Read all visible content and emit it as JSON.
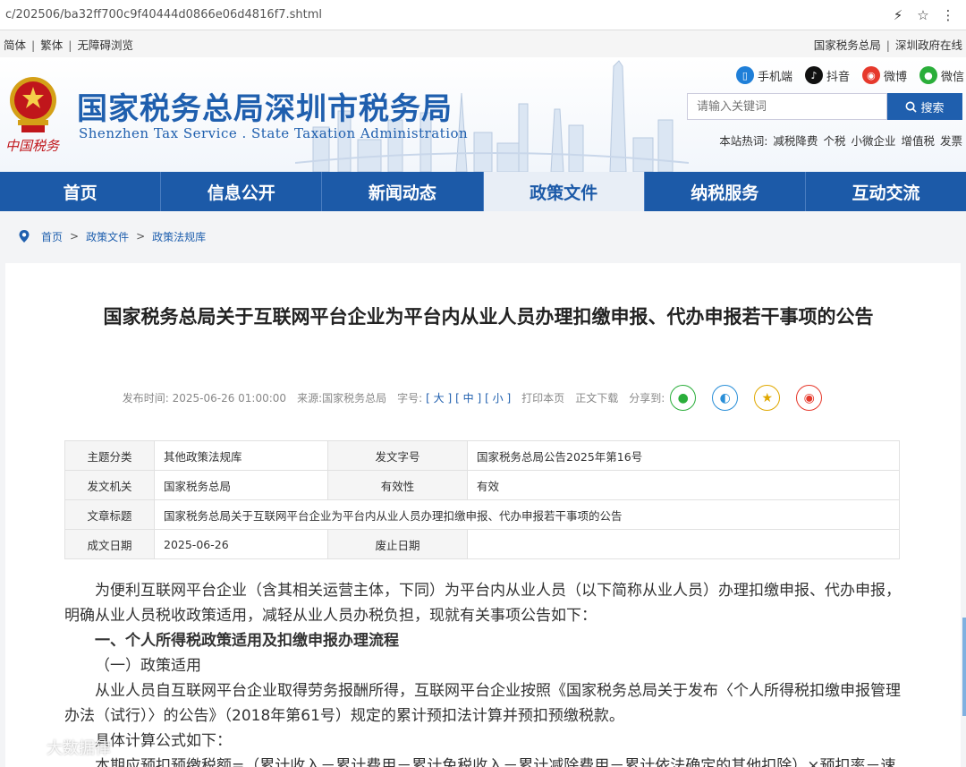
{
  "browser": {
    "url": "c/202506/ba32ff700c9f40444d0866e06d4816f7.shtml",
    "icons": [
      "lightning-icon",
      "star-icon",
      "more-icon"
    ]
  },
  "topstrip": {
    "left": [
      "简体",
      "繁体",
      "无障碍浏览"
    ],
    "right": [
      "国家税务总局",
      "深圳政府在线"
    ]
  },
  "header": {
    "emblem_text": "中国税务",
    "title": "国家税务总局深圳市税务局",
    "subtitle": "Shenzhen Tax Service . State Taxation Administration",
    "social": [
      {
        "label": "手机端",
        "icon": "mobile-icon",
        "color": "#1f7fd8"
      },
      {
        "label": "抖音",
        "icon": "douyin-icon",
        "color": "#111111"
      },
      {
        "label": "微博",
        "icon": "weibo-icon",
        "color": "#e6392c"
      },
      {
        "label": "微信",
        "icon": "wechat-icon",
        "color": "#2aae3a"
      }
    ],
    "search": {
      "placeholder": "请输入关键词",
      "button": "搜索"
    },
    "hotwords_label": "本站热词:",
    "hotwords": [
      "减税降费",
      "个税",
      "小微企业",
      "增值税",
      "发票"
    ]
  },
  "nav": {
    "tabs": [
      "首页",
      "信息公开",
      "新闻动态",
      "政策文件",
      "纳税服务",
      "互动交流"
    ],
    "active_index": 3
  },
  "breadcrumb": [
    "首页",
    "政策文件",
    "政策法规库"
  ],
  "article": {
    "title": "国家税务总局关于互联网平台企业为平台内从业人员办理扣缴申报、代办申报若干事项的公告",
    "meta": {
      "time_label": "发布时间:",
      "time": "2025-06-26 01:00:00",
      "source_label": "来源:",
      "source": "国家税务总局",
      "size_label": "字号:",
      "sizes": [
        "[ 大 ]",
        "[ 中 ]",
        "[ 小 ]"
      ],
      "print": "打印本页",
      "download": "正文下载",
      "share_label": "分享到:"
    },
    "info": {
      "row1": {
        "k1": "主题分类",
        "v1": "其他政策法规库",
        "k2": "发文字号",
        "v2": "国家税务总局公告2025年第16号"
      },
      "row2": {
        "k1": "发文机关",
        "v1": "国家税务总局",
        "k2": "有效性",
        "v2": "有效"
      },
      "row3": {
        "k1": "文章标题",
        "v1": "国家税务总局关于互联网平台企业为平台内从业人员办理扣缴申报、代办申报若干事项的公告"
      },
      "row4": {
        "k1": "成文日期",
        "v1": "2025-06-26",
        "k2": "废止日期",
        "v2": ""
      }
    },
    "paragraphs": {
      "p1": "为便利互联网平台企业（含其相关运营主体，下同）为平台内从业人员（以下简称从业人员）办理扣缴申报、代办申报，明确从业人员税收政策适用，减轻从业人员办税负担，现就有关事项公告如下：",
      "h1": "一、个人所得税政策适用及扣缴申报办理流程",
      "s1": "（一）政策适用",
      "p2": "从业人员自互联网平台企业取得劳务报酬所得，互联网平台企业按照《国家税务总局关于发布〈个人所得税扣缴申报管理办法（试行）〉的公告》（2018年第61号）规定的累计预扣法计算并预扣预缴税款。",
      "p3": "具体计算公式如下：",
      "p4": "本期应预扣预缴税额=（累计收入－累计费用－累计免税收入－累计减除费用－累计依法确定的其他扣除）×预扣率－速"
    }
  },
  "watermark": "大数据律"
}
